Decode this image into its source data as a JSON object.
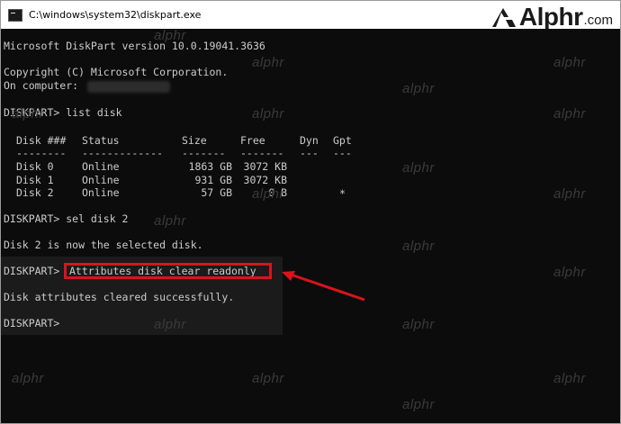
{
  "window": {
    "title": "C:\\windows\\system32\\diskpart.exe"
  },
  "brand": {
    "logo_text": "Alphr",
    "logo_suffix": ".com",
    "watermark": "alphr"
  },
  "console": {
    "version_line": "Microsoft DiskPart version 10.0.19041.3636",
    "copyright_line": "Copyright (C) Microsoft Corporation.",
    "computer_line": "On computer:",
    "cmd_list_disk": "DISKPART> list disk",
    "table": {
      "headers": [
        "Disk ###",
        "Status",
        "Size",
        "Free",
        "Dyn",
        "Gpt"
      ],
      "separators": [
        "--------",
        "-------------",
        "-------",
        "-------",
        "---",
        "---"
      ],
      "rows": [
        {
          "disk": "Disk 0",
          "status": "Online",
          "size": "1863 GB",
          "free": "3072 KB",
          "dyn": "",
          "gpt": ""
        },
        {
          "disk": "Disk 1",
          "status": "Online",
          "size": "931 GB",
          "free": "3072 KB",
          "dyn": "",
          "gpt": ""
        },
        {
          "disk": "Disk 2",
          "status": "Online",
          "size": "57 GB",
          "free": "0 B",
          "dyn": "",
          "gpt": "*"
        }
      ]
    },
    "cmd_sel_disk": "DISKPART> sel disk 2",
    "selected_msg": "Disk 2 is now the selected disk.",
    "prompt": "DISKPART>",
    "cmd_attributes": "Attributes disk clear readonly",
    "cleared_msg": "Disk attributes cleared successfully.",
    "final_prompt": "DISKPART>"
  },
  "colors": {
    "console_bg": "#0c0c0c",
    "console_text": "#cccccc",
    "highlight": "#d9141b"
  }
}
